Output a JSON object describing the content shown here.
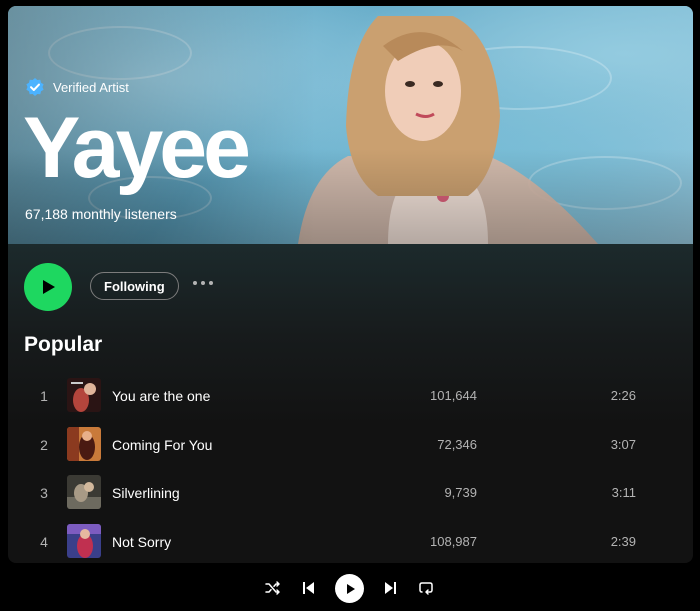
{
  "artist": {
    "verified_label": "Verified Artist",
    "name": "Yayee",
    "monthly_listeners": "67,188 monthly listeners"
  },
  "controls": {
    "follow_label": "Following"
  },
  "popular": {
    "title": "Popular",
    "tracks": [
      {
        "num": "1",
        "title": "You are the one",
        "plays": "101,644",
        "duration": "2:26"
      },
      {
        "num": "2",
        "title": "Coming For You",
        "plays": "72,346",
        "duration": "3:07"
      },
      {
        "num": "3",
        "title": "Silverlining",
        "plays": "9,739",
        "duration": "3:11"
      },
      {
        "num": "4",
        "title": "Not Sorry",
        "plays": "108,987",
        "duration": "2:39"
      }
    ]
  },
  "colors": {
    "accent": "#1ed760",
    "verified": "#4cb3ff",
    "background": "#121212"
  },
  "icons": [
    "verified-badge-icon",
    "play-icon",
    "more-icon",
    "shuffle-icon",
    "previous-icon",
    "next-icon",
    "repeat-icon"
  ]
}
